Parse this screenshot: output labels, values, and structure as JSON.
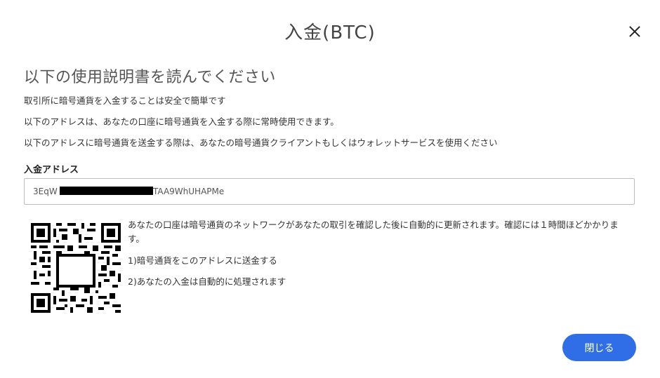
{
  "modal": {
    "title": "入金(BTC)"
  },
  "instructions": {
    "heading": "以下の使用説明書を読んでください",
    "paragraphs": [
      "取引所に暗号通貨を入金することは安全で簡単です",
      "以下のアドレスは、あなたの口座に暗号通貨を入金する際に常時使用できます。",
      "以下のアドレスに暗号通貨を送金する際は、あなたの暗号通貨クライアントもしくはウォレットサービスを使用ください"
    ]
  },
  "deposit_address": {
    "label": "入金アドレス",
    "value_prefix": "3EqW",
    "value_suffix": "TAA9WhUHAPMe"
  },
  "info": {
    "text": "あなたの口座は暗号通貨のネットワークがあなたの取引を確認した後に自動的に更新されます。確認には１時間ほどかかります。",
    "steps": [
      "1)暗号通貨をこのアドレスに送金する",
      "2)あなたの入金は自動的に処理されます"
    ]
  },
  "buttons": {
    "close_label": "閉じる"
  },
  "icons": {
    "close": "close-x-icon",
    "qr": "qr-code-image"
  },
  "colors": {
    "primary_button": "#2f6ee6"
  }
}
